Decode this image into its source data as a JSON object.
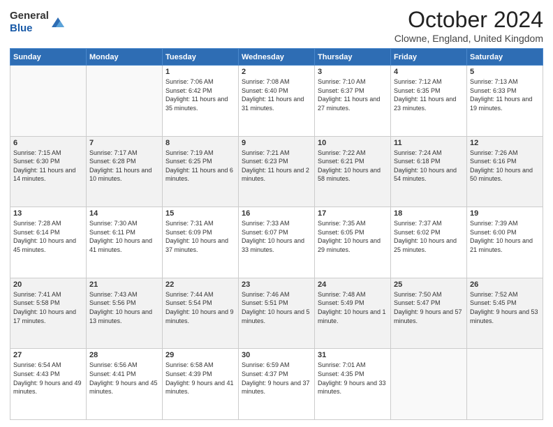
{
  "header": {
    "logo_general": "General",
    "logo_blue": "Blue",
    "month_title": "October 2024",
    "location": "Clowne, England, United Kingdom"
  },
  "days_of_week": [
    "Sunday",
    "Monday",
    "Tuesday",
    "Wednesday",
    "Thursday",
    "Friday",
    "Saturday"
  ],
  "weeks": [
    [
      {
        "day": "",
        "sunrise": "",
        "sunset": "",
        "daylight": ""
      },
      {
        "day": "",
        "sunrise": "",
        "sunset": "",
        "daylight": ""
      },
      {
        "day": "1",
        "sunrise": "Sunrise: 7:06 AM",
        "sunset": "Sunset: 6:42 PM",
        "daylight": "Daylight: 11 hours and 35 minutes."
      },
      {
        "day": "2",
        "sunrise": "Sunrise: 7:08 AM",
        "sunset": "Sunset: 6:40 PM",
        "daylight": "Daylight: 11 hours and 31 minutes."
      },
      {
        "day": "3",
        "sunrise": "Sunrise: 7:10 AM",
        "sunset": "Sunset: 6:37 PM",
        "daylight": "Daylight: 11 hours and 27 minutes."
      },
      {
        "day": "4",
        "sunrise": "Sunrise: 7:12 AM",
        "sunset": "Sunset: 6:35 PM",
        "daylight": "Daylight: 11 hours and 23 minutes."
      },
      {
        "day": "5",
        "sunrise": "Sunrise: 7:13 AM",
        "sunset": "Sunset: 6:33 PM",
        "daylight": "Daylight: 11 hours and 19 minutes."
      }
    ],
    [
      {
        "day": "6",
        "sunrise": "Sunrise: 7:15 AM",
        "sunset": "Sunset: 6:30 PM",
        "daylight": "Daylight: 11 hours and 14 minutes."
      },
      {
        "day": "7",
        "sunrise": "Sunrise: 7:17 AM",
        "sunset": "Sunset: 6:28 PM",
        "daylight": "Daylight: 11 hours and 10 minutes."
      },
      {
        "day": "8",
        "sunrise": "Sunrise: 7:19 AM",
        "sunset": "Sunset: 6:25 PM",
        "daylight": "Daylight: 11 hours and 6 minutes."
      },
      {
        "day": "9",
        "sunrise": "Sunrise: 7:21 AM",
        "sunset": "Sunset: 6:23 PM",
        "daylight": "Daylight: 11 hours and 2 minutes."
      },
      {
        "day": "10",
        "sunrise": "Sunrise: 7:22 AM",
        "sunset": "Sunset: 6:21 PM",
        "daylight": "Daylight: 10 hours and 58 minutes."
      },
      {
        "day": "11",
        "sunrise": "Sunrise: 7:24 AM",
        "sunset": "Sunset: 6:18 PM",
        "daylight": "Daylight: 10 hours and 54 minutes."
      },
      {
        "day": "12",
        "sunrise": "Sunrise: 7:26 AM",
        "sunset": "Sunset: 6:16 PM",
        "daylight": "Daylight: 10 hours and 50 minutes."
      }
    ],
    [
      {
        "day": "13",
        "sunrise": "Sunrise: 7:28 AM",
        "sunset": "Sunset: 6:14 PM",
        "daylight": "Daylight: 10 hours and 45 minutes."
      },
      {
        "day": "14",
        "sunrise": "Sunrise: 7:30 AM",
        "sunset": "Sunset: 6:11 PM",
        "daylight": "Daylight: 10 hours and 41 minutes."
      },
      {
        "day": "15",
        "sunrise": "Sunrise: 7:31 AM",
        "sunset": "Sunset: 6:09 PM",
        "daylight": "Daylight: 10 hours and 37 minutes."
      },
      {
        "day": "16",
        "sunrise": "Sunrise: 7:33 AM",
        "sunset": "Sunset: 6:07 PM",
        "daylight": "Daylight: 10 hours and 33 minutes."
      },
      {
        "day": "17",
        "sunrise": "Sunrise: 7:35 AM",
        "sunset": "Sunset: 6:05 PM",
        "daylight": "Daylight: 10 hours and 29 minutes."
      },
      {
        "day": "18",
        "sunrise": "Sunrise: 7:37 AM",
        "sunset": "Sunset: 6:02 PM",
        "daylight": "Daylight: 10 hours and 25 minutes."
      },
      {
        "day": "19",
        "sunrise": "Sunrise: 7:39 AM",
        "sunset": "Sunset: 6:00 PM",
        "daylight": "Daylight: 10 hours and 21 minutes."
      }
    ],
    [
      {
        "day": "20",
        "sunrise": "Sunrise: 7:41 AM",
        "sunset": "Sunset: 5:58 PM",
        "daylight": "Daylight: 10 hours and 17 minutes."
      },
      {
        "day": "21",
        "sunrise": "Sunrise: 7:43 AM",
        "sunset": "Sunset: 5:56 PM",
        "daylight": "Daylight: 10 hours and 13 minutes."
      },
      {
        "day": "22",
        "sunrise": "Sunrise: 7:44 AM",
        "sunset": "Sunset: 5:54 PM",
        "daylight": "Daylight: 10 hours and 9 minutes."
      },
      {
        "day": "23",
        "sunrise": "Sunrise: 7:46 AM",
        "sunset": "Sunset: 5:51 PM",
        "daylight": "Daylight: 10 hours and 5 minutes."
      },
      {
        "day": "24",
        "sunrise": "Sunrise: 7:48 AM",
        "sunset": "Sunset: 5:49 PM",
        "daylight": "Daylight: 10 hours and 1 minute."
      },
      {
        "day": "25",
        "sunrise": "Sunrise: 7:50 AM",
        "sunset": "Sunset: 5:47 PM",
        "daylight": "Daylight: 9 hours and 57 minutes."
      },
      {
        "day": "26",
        "sunrise": "Sunrise: 7:52 AM",
        "sunset": "Sunset: 5:45 PM",
        "daylight": "Daylight: 9 hours and 53 minutes."
      }
    ],
    [
      {
        "day": "27",
        "sunrise": "Sunrise: 6:54 AM",
        "sunset": "Sunset: 4:43 PM",
        "daylight": "Daylight: 9 hours and 49 minutes."
      },
      {
        "day": "28",
        "sunrise": "Sunrise: 6:56 AM",
        "sunset": "Sunset: 4:41 PM",
        "daylight": "Daylight: 9 hours and 45 minutes."
      },
      {
        "day": "29",
        "sunrise": "Sunrise: 6:58 AM",
        "sunset": "Sunset: 4:39 PM",
        "daylight": "Daylight: 9 hours and 41 minutes."
      },
      {
        "day": "30",
        "sunrise": "Sunrise: 6:59 AM",
        "sunset": "Sunset: 4:37 PM",
        "daylight": "Daylight: 9 hours and 37 minutes."
      },
      {
        "day": "31",
        "sunrise": "Sunrise: 7:01 AM",
        "sunset": "Sunset: 4:35 PM",
        "daylight": "Daylight: 9 hours and 33 minutes."
      },
      {
        "day": "",
        "sunrise": "",
        "sunset": "",
        "daylight": ""
      },
      {
        "day": "",
        "sunrise": "",
        "sunset": "",
        "daylight": ""
      }
    ]
  ]
}
